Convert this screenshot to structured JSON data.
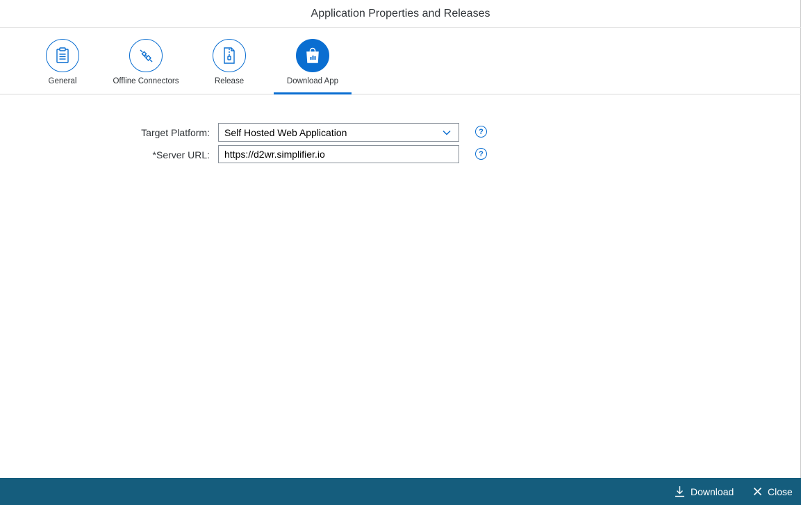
{
  "dialog": {
    "title": "Application Properties and Releases"
  },
  "tabs": [
    {
      "label": "General",
      "icon": "clipboard-icon",
      "active": false
    },
    {
      "label": "Offline Connectors",
      "icon": "plug-icon",
      "active": false
    },
    {
      "label": "Release",
      "icon": "zip-file-icon",
      "active": false
    },
    {
      "label": "Download App",
      "icon": "shopping-bag-icon",
      "active": true
    }
  ],
  "form": {
    "target_platform": {
      "label": "Target Platform:",
      "value": "Self Hosted Web Application"
    },
    "server_url": {
      "label": "*Server URL:",
      "value": "https://d2wr.simplifier.io"
    },
    "help_glyph": "?"
  },
  "footer": {
    "download_label": "Download",
    "close_label": "Close"
  },
  "colors": {
    "accent": "#0a6ed1",
    "footer_bg": "#155d7d",
    "text": "#32363a"
  }
}
